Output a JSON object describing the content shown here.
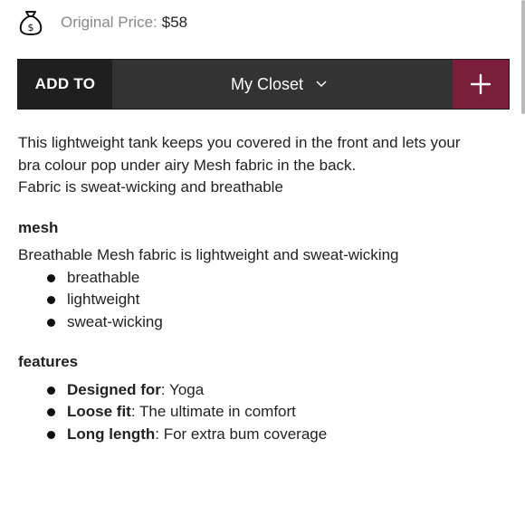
{
  "price": {
    "label": "Original Price:",
    "value": "$58",
    "icon": "money-bag-icon"
  },
  "add_bar": {
    "add_to_label": "ADD TO",
    "closet_selected": "My Closet",
    "chevron_icon": "chevron-down-icon",
    "plus_icon": "plus-icon",
    "colors": {
      "add_to_bg": "#1f1f1f",
      "select_bg": "#333333",
      "plus_bg": "#7a1e3b"
    }
  },
  "description": {
    "lines": [
      "This lightweight tank keeps you covered in the front and lets your",
      "bra colour pop under airy Mesh fabric in the back.",
      "Fabric is sweat-wicking and breathable"
    ]
  },
  "mesh": {
    "title": "mesh",
    "intro": "Breathable Mesh fabric is lightweight and sweat-wicking",
    "bullets": [
      "breathable",
      "lightweight",
      "sweat-wicking"
    ]
  },
  "features": {
    "title": "features",
    "items": [
      {
        "key": "Designed for",
        "value": ": Yoga"
      },
      {
        "key": "Loose fit",
        "value": ": The ultimate in comfort"
      },
      {
        "key": "Long length",
        "value": ": For extra bum coverage"
      }
    ]
  }
}
